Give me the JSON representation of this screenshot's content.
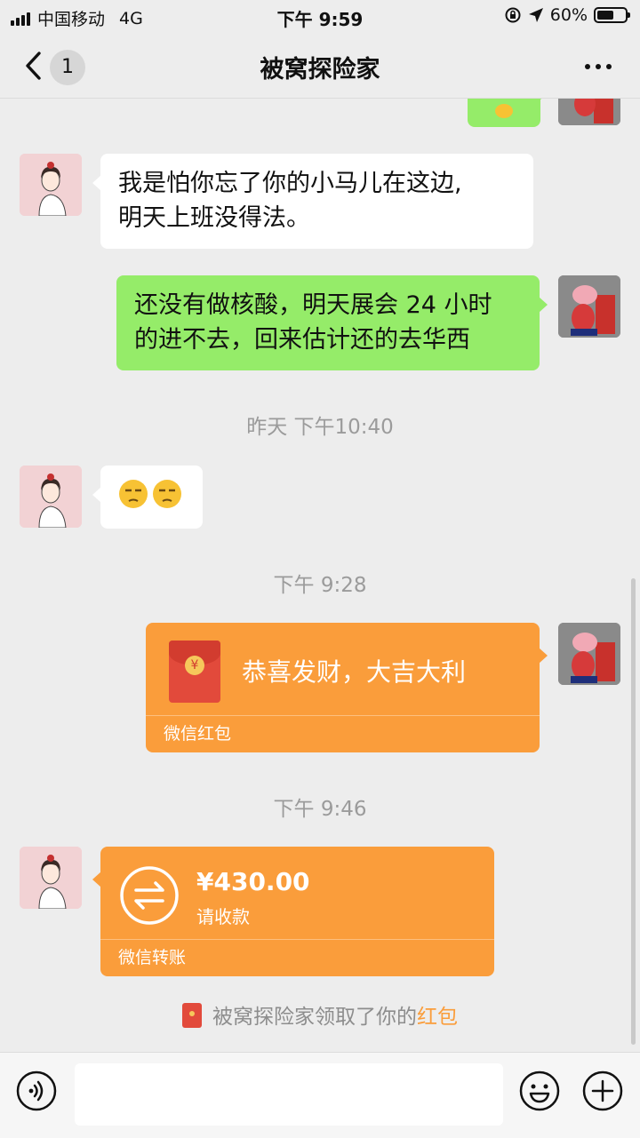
{
  "status_bar": {
    "carrier": "中国移动",
    "network": "4G",
    "time": "下午 9:59",
    "battery_text": "60%",
    "battery_level": 0.6
  },
  "nav": {
    "unread_count": "1",
    "title": "被窝探险家"
  },
  "messages": {
    "m1": {
      "from": "other",
      "text": "我是怕你忘了你的小马儿在这边,\n明天上班没得法。"
    },
    "m2": {
      "from": "me",
      "text": "还没有做核酸，明天展会 24 小时\n的进不去，回来估计还的去华西"
    },
    "ts1": "昨天 下午10:40",
    "m3": {
      "from": "other",
      "text": "😒😒"
    },
    "ts2": "下午 9:28",
    "red_packet": {
      "from": "me",
      "greeting": "恭喜发财，大吉大利",
      "footer": "微信红包"
    },
    "ts3": "下午 9:46",
    "transfer": {
      "from": "other",
      "amount": "¥430.00",
      "note": "请收款",
      "footer": "微信转账"
    },
    "system": {
      "prefix": "被窝探险家领取了你的",
      "highlight": "红包"
    }
  },
  "icons": {
    "back": "chevron-left-icon",
    "more": "more-dots-icon",
    "voice": "voice-icon",
    "emoji": "emoji-icon",
    "plus": "plus-icon"
  },
  "colors": {
    "chat_bg": "#ededed",
    "my_bubble": "#95ec69",
    "other_bubble": "#ffffff",
    "wechat_pay_orange": "#fa9d3b",
    "red_envelope": "#e24a3b"
  }
}
